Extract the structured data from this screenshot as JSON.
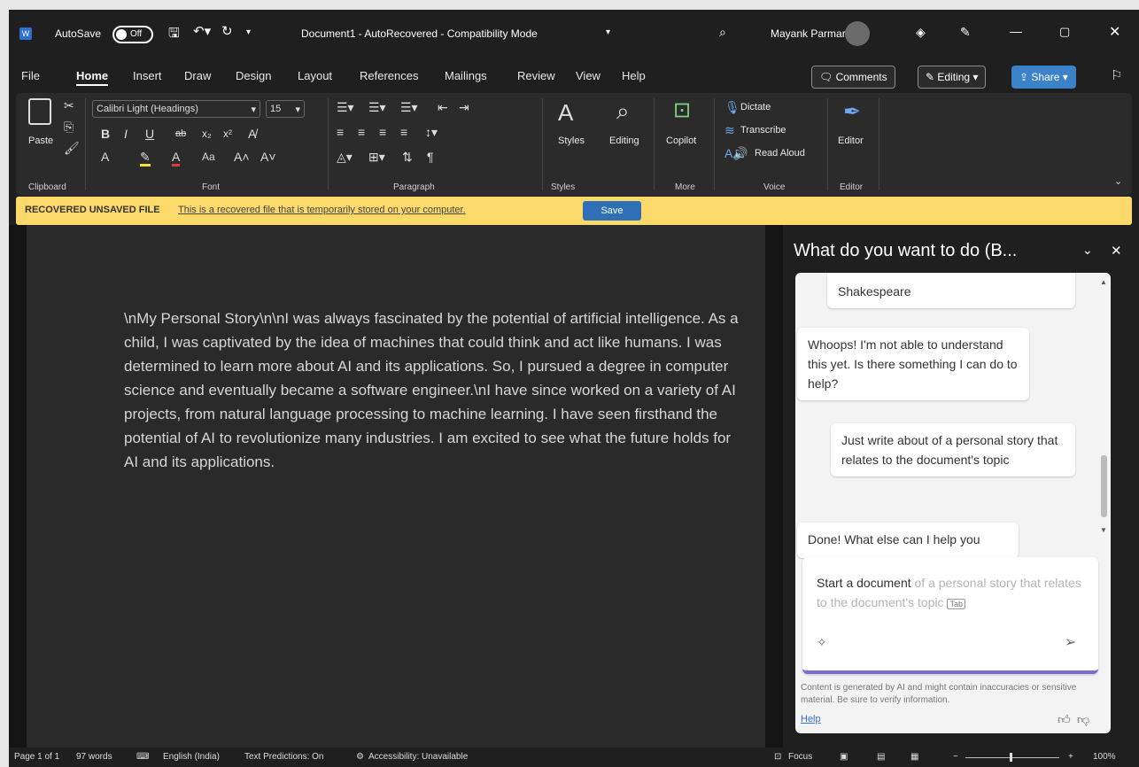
{
  "titlebar": {
    "autosave_label": "AutoSave",
    "autosave_state": "Off",
    "doc_title": "Document1 - AutoRecovered - Compatibility Mode",
    "user_name": "Mayank Parmar"
  },
  "menu": {
    "items": [
      "File",
      "Home",
      "Insert",
      "Draw",
      "Design",
      "Layout",
      "References",
      "Mailings",
      "Review",
      "View",
      "Help"
    ],
    "comments": "Comments",
    "editing": "Editing",
    "share": "Share"
  },
  "ribbon": {
    "paste": "Paste",
    "font_name": "Calibri Light (Headings)",
    "font_size": "15",
    "styles": "Styles",
    "editing": "Editing",
    "copilot": "Copilot",
    "dictate": "Dictate",
    "transcribe": "Transcribe",
    "read_aloud": "Read Aloud",
    "editor": "Editor",
    "groups": {
      "clipboard": "Clipboard",
      "font": "Font",
      "paragraph": "Paragraph",
      "styles": "Styles",
      "more": "More",
      "voice": "Voice",
      "editor": "Editor"
    }
  },
  "banner": {
    "label": "RECOVERED UNSAVED FILE",
    "message": "This is a recovered file that is temporarily stored on your computer.",
    "save": "Save"
  },
  "document": {
    "text": "\\nMy Personal Story\\n\\nI was always fascinated by the potential of artificial intelligence. As a child, I was captivated by the idea of machines that could think and act like humans. I was determined to learn more about AI and its applications. So, I pursued a degree in computer science and eventually became a software engineer.\\nI have since worked on a variety of AI projects, from natural language processing to machine learning. I have seen firsthand the potential of AI to revolutionize many industries. I am excited to see what the future holds for AI and its applications."
  },
  "copilot": {
    "title": "What do you want to do (B...",
    "messages": [
      {
        "role": "user",
        "text": "Shakespeare"
      },
      {
        "role": "assistant",
        "text": "Whoops! I'm not able to understand this yet. Is there something I can do to help?"
      },
      {
        "role": "user",
        "text": "Just write about of a personal story that relates to the document's topic"
      },
      {
        "role": "assistant",
        "text": "Done! What else can I help you"
      }
    ],
    "input_typed": "Start a document",
    "input_suggestion": "of a personal story that relates to the document's topic",
    "tab_hint": "Tab",
    "disclaimer": "Content is generated by AI and might contain inaccuracies or sensitive material. Be sure to verify information.",
    "help": "Help"
  },
  "status": {
    "page": "Page 1 of 1",
    "words": "97 words",
    "language": "English (India)",
    "predictions": "Text Predictions: On",
    "accessibility": "Accessibility: Unavailable",
    "focus": "Focus",
    "zoom": "100%"
  },
  "colors": {
    "accent": "#3b82c8",
    "banner": "#fcd96b"
  }
}
